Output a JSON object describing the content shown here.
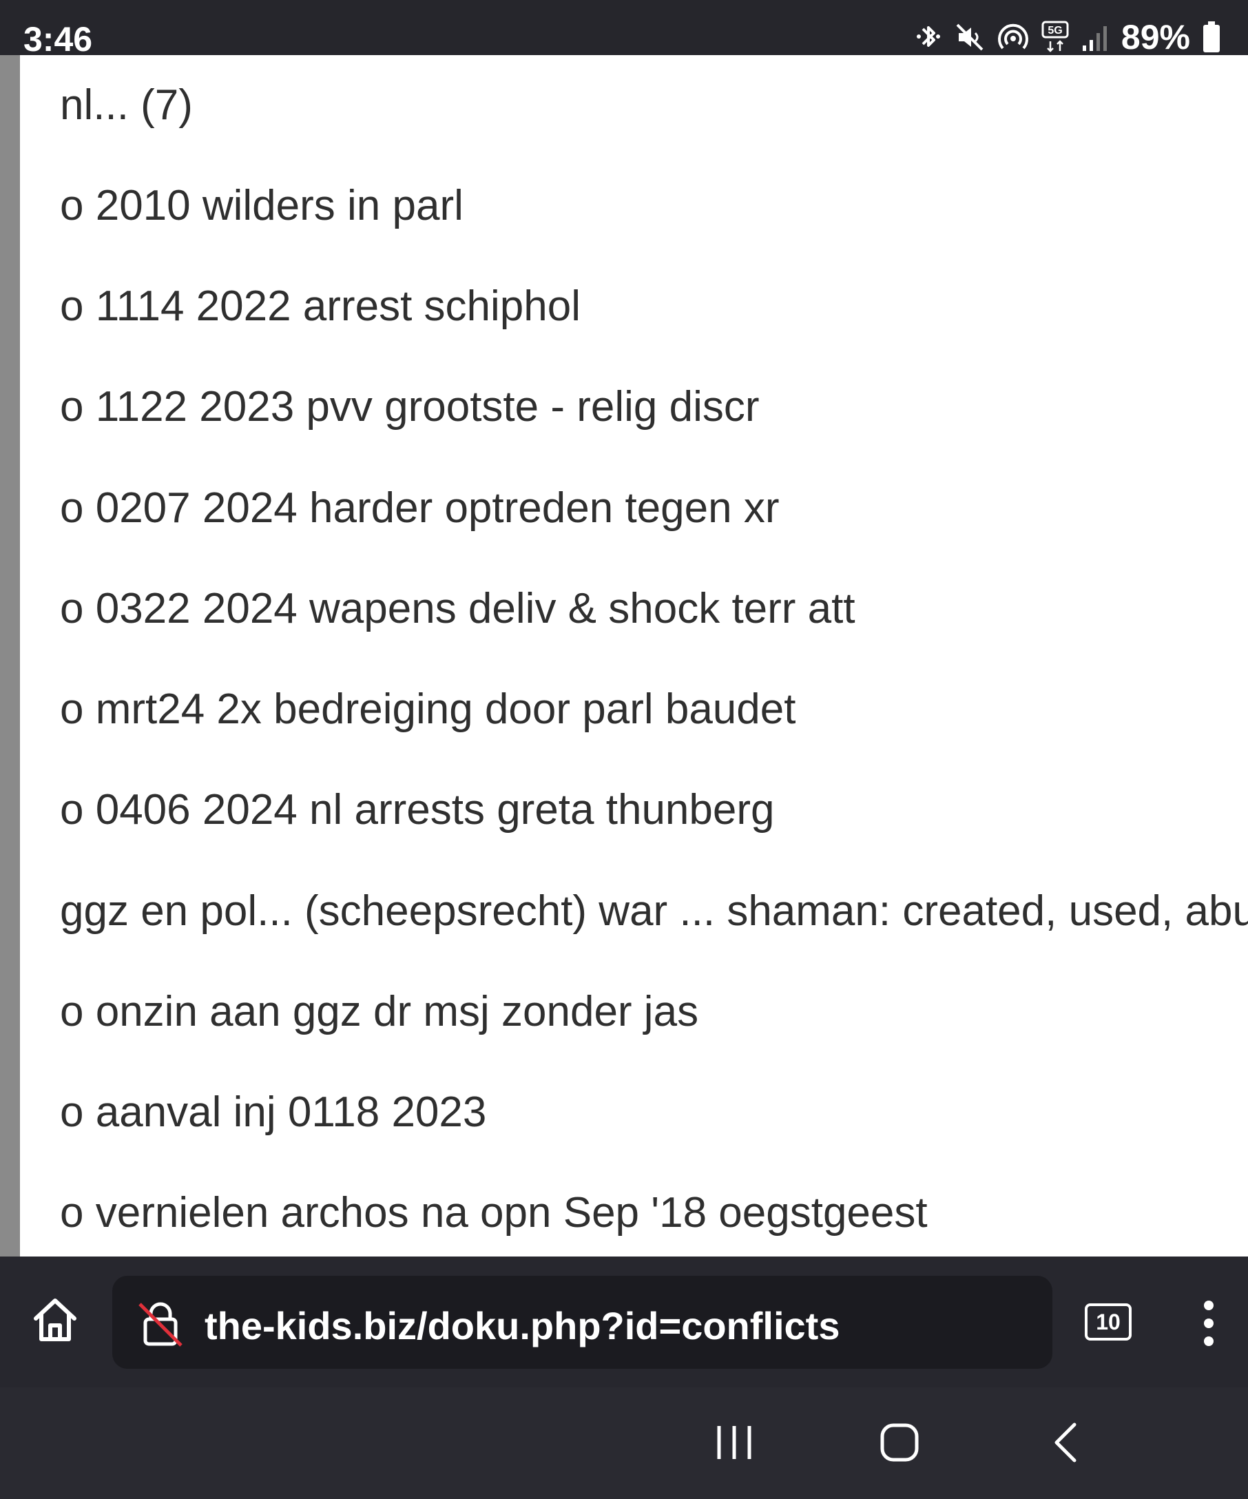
{
  "status_bar": {
    "time": "3:46",
    "battery": "89%",
    "network_badge": "5G",
    "icons": [
      "bluetooth-icon",
      "mute-icon",
      "hotspot-icon",
      "5g-icon",
      "signal-icon",
      "battery-icon"
    ]
  },
  "page": {
    "lines": [
      "nl... (7)",
      "o 2010 wilders in parl",
      "o 1114 2022 arrest schiphol",
      "o 1122 2023 pvv grootste - relig discr",
      "o 0207 2024 harder optreden tegen xr",
      "o 0322 2024 wapens deliv & shock terr att",
      "o mrt24 2x bedreiging door parl baudet",
      "o 0406 2024 nl arrests greta thunberg",
      "ggz en pol... (scheepsrecht) war ... shaman: created, used, abu",
      "o onzin aan ggz dr msj zonder jas",
      "o aanval inj 0118 2023",
      "o vernielen archos na opn Sep '18 oegstgeest"
    ]
  },
  "browser": {
    "url": "the-kids.biz/doku.php?id=conflicts",
    "tab_count": "10"
  },
  "colors": {
    "status_bar_bg": "#26262c",
    "page_bg": "#ffffff",
    "text": "#2f2f2f",
    "url_box_bg": "#1b1b20",
    "insecure_red": "#e0303a"
  }
}
